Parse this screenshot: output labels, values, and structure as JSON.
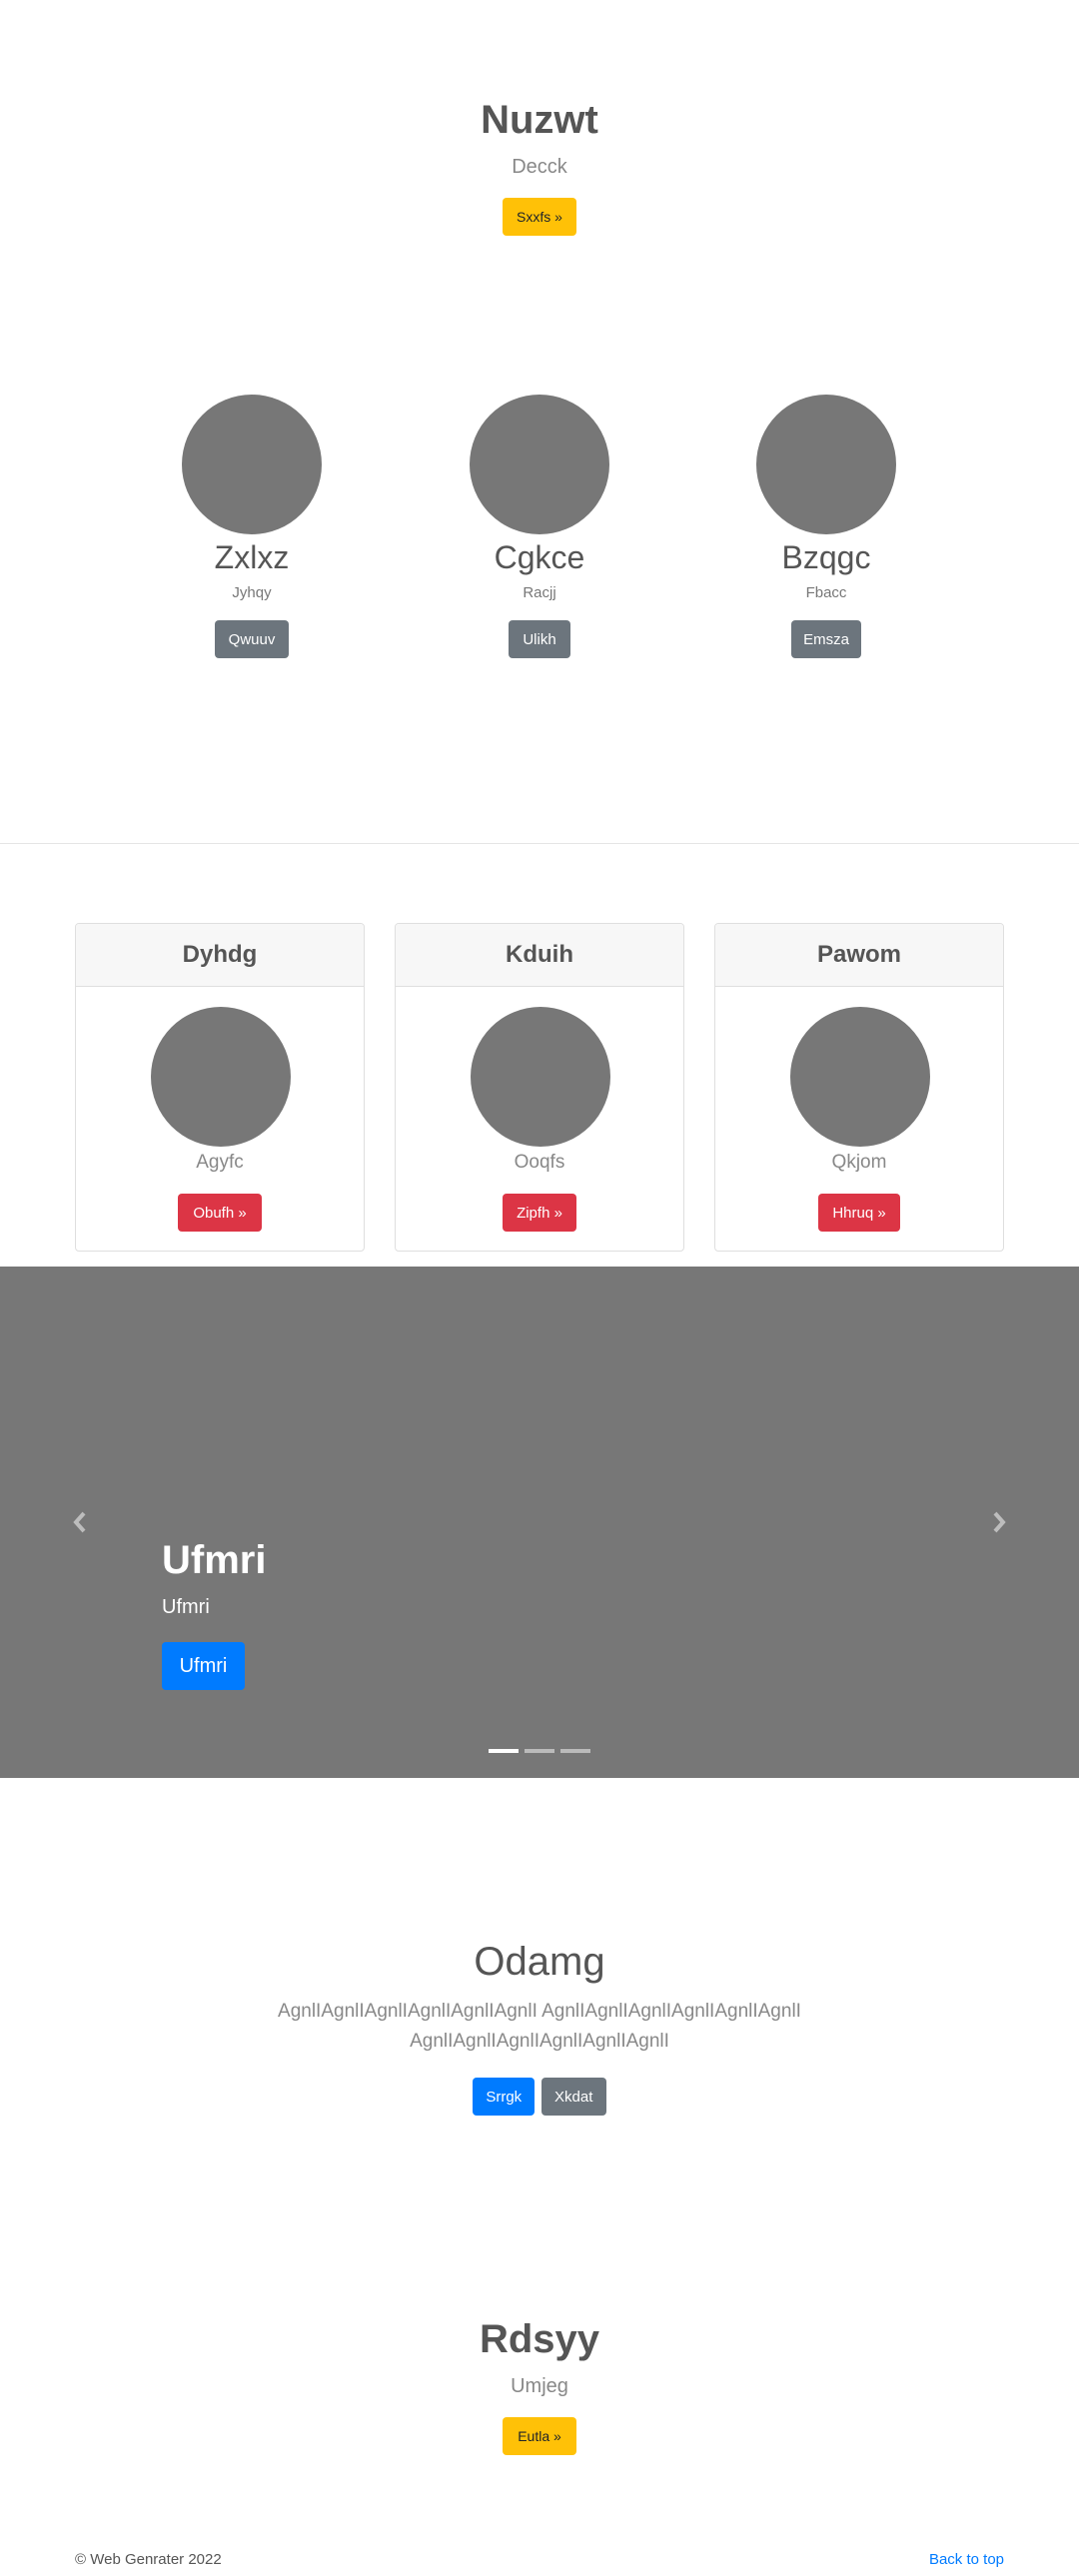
{
  "hero": {
    "title": "Nuzwt",
    "subtitle": "Decck",
    "button_label": "Sxxfs »"
  },
  "profiles": [
    {
      "name": "Zxlxz",
      "role": "Jyhqy",
      "button_label": "Qwuuv"
    },
    {
      "name": "Cgkce",
      "role": "Racjj",
      "button_label": "Ulikh"
    },
    {
      "name": "Bzqgc",
      "role": "Fbacc",
      "button_label": "Emsza"
    }
  ],
  "cards": [
    {
      "header": "Dyhdg",
      "caption": "Agyfc",
      "button_label": "Obufh »"
    },
    {
      "header": "Kduih",
      "caption": "Ooqfs",
      "button_label": "Zipfh »"
    },
    {
      "header": "Pawom",
      "caption": "Qkjom",
      "button_label": "Hhruq »"
    }
  ],
  "carousel": {
    "heading": "Ufmri",
    "text": "Ufmri",
    "button_label": "Ufmri",
    "prev_icon": "chevron-left-icon",
    "next_icon": "chevron-right-icon",
    "slide_count": 3,
    "active_slide": 1
  },
  "feature": {
    "title": "Odamg",
    "paragraph": "AgnlIAgnlIAgnlIAgnlIAgnlIAgnlI AgnlIAgnlIAgnlIAgnlIAgnlIAgnlI AgnlIAgnlIAgnlIAgnlIAgnlIAgnlI",
    "primary_button": "Srrgk",
    "secondary_button": "Xkdat"
  },
  "cta": {
    "title": "Rdsyy",
    "subtitle": "Umjeg",
    "button_label": "Eutla »"
  },
  "footer": {
    "copyright": "© Web Genrater 2022",
    "back_to_top": "Back to top"
  },
  "colors": {
    "placeholder_gray": "#777777",
    "warning": "#ffc107",
    "secondary": "#6c757d",
    "danger": "#dc3545",
    "primary": "#007bff"
  }
}
